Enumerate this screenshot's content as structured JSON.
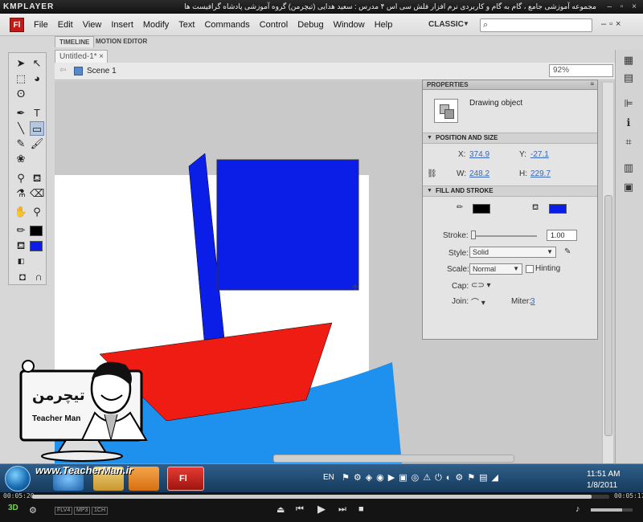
{
  "player": {
    "logo": "KMPLAYER",
    "caption": "مجموعه آموزشی جامع ، گام به گام و کاربردی نرم افزار فلش سی اس ۴ مدرس : سعید هدایی (تیچرمن) گروه آموزشی پادشاه گرافیست ها",
    "window_buttons": "– ▫ ×",
    "time_current": "00:05:20",
    "time_total": "00:05:17",
    "progress": 0.97,
    "volume": 0.75,
    "badges": [
      "FLV4",
      "MP3",
      "1CH"
    ],
    "mode_3d": "3D"
  },
  "flash": {
    "app_logo": "Fl",
    "menu": [
      "File",
      "Edit",
      "View",
      "Insert",
      "Modify",
      "Text",
      "Commands",
      "Control",
      "Debug",
      "Window",
      "Help"
    ],
    "workspace": "CLASSIC",
    "panel_tabs": [
      "TIMELINE",
      "MOTION EDITOR"
    ],
    "doc_tab": "Untitled-1*",
    "scene": "Scene 1",
    "zoom": "92%",
    "properties": {
      "title": "PROPERTIES",
      "object": "Drawing object",
      "position_section": "POSITION AND SIZE",
      "x_label": "X:",
      "x": "374.9",
      "y_label": "Y:",
      "y": "-27.1",
      "w_label": "W:",
      "w": "248.2",
      "h_label": "H:",
      "h": "229.7",
      "fill_section": "FILL AND STROKE",
      "stroke_color": "#000000",
      "fill_color": "#0a1ee8",
      "stroke_label": "Stroke:",
      "stroke_value": "1.00",
      "style_label": "Style:",
      "style_value": "Solid",
      "scale_label": "Scale:",
      "scale_value": "Normal",
      "hinting_label": "Hinting",
      "cap_label": "Cap:",
      "join_label": "Join:",
      "miter_label": "Miter:",
      "miter_value": "3"
    }
  },
  "watermark": {
    "site": "www.TeacherMan.ir",
    "name": "Teacher Man",
    "logo_text": "تیچرمن"
  },
  "taskbar": {
    "lang": "EN",
    "time": "11:51 AM",
    "date": "1/8/2011"
  },
  "colors": {
    "sail": "#0a1ee8",
    "hull": "#ee1c12",
    "water": "#1e90ee",
    "stroke": "#000000"
  }
}
